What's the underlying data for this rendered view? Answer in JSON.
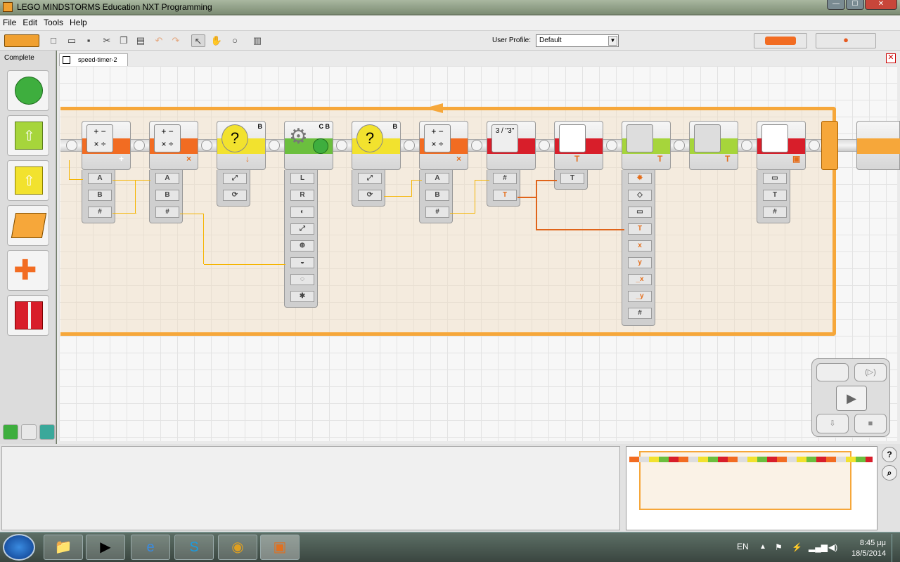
{
  "window": {
    "title": "LEGO MINDSTORMS Education NXT Programming",
    "minimize": "—",
    "maximize": "☐",
    "close": "✕"
  },
  "menu": {
    "file": "File",
    "edit": "Edit",
    "tools": "Tools",
    "help": "Help"
  },
  "toolbar": {
    "profile_label": "User Profile:",
    "profile_value": "Default"
  },
  "palette": {
    "title": "Complete"
  },
  "tab": {
    "label": "speed-timer-2"
  },
  "blocks": [
    {
      "label": "",
      "port": "+"
    },
    {
      "label": "",
      "port": "×"
    },
    {
      "label": "B",
      "port": "↓"
    },
    {
      "label": "C B",
      "port": "⏱"
    },
    {
      "label": "B",
      "port": "⟳"
    },
    {
      "label": "",
      "port": "×"
    },
    {
      "label": "",
      "port": "#"
    },
    {
      "label": "",
      "port": "T"
    },
    {
      "label": "",
      "port": "T"
    },
    {
      "label": "",
      "port": "T"
    },
    {
      "label": "",
      "port": "▣"
    }
  ],
  "plugs": {
    "a": "A",
    "b": "B",
    "num": "#",
    "text": "T",
    "x": "x",
    "y": "y",
    "ux": "_x",
    "uy": "_y",
    "three_quote": "3 / \"3\""
  },
  "tray": {
    "lang": "EN",
    "time": "8:45 μμ",
    "date": "18/5/2014"
  },
  "colors": {
    "loop": "#f6a73a",
    "math": "#f26c22",
    "sensor": "#f2e22e",
    "motor": "#6bbf3e",
    "text": "#d81e2a",
    "display": "#a6d53b"
  }
}
